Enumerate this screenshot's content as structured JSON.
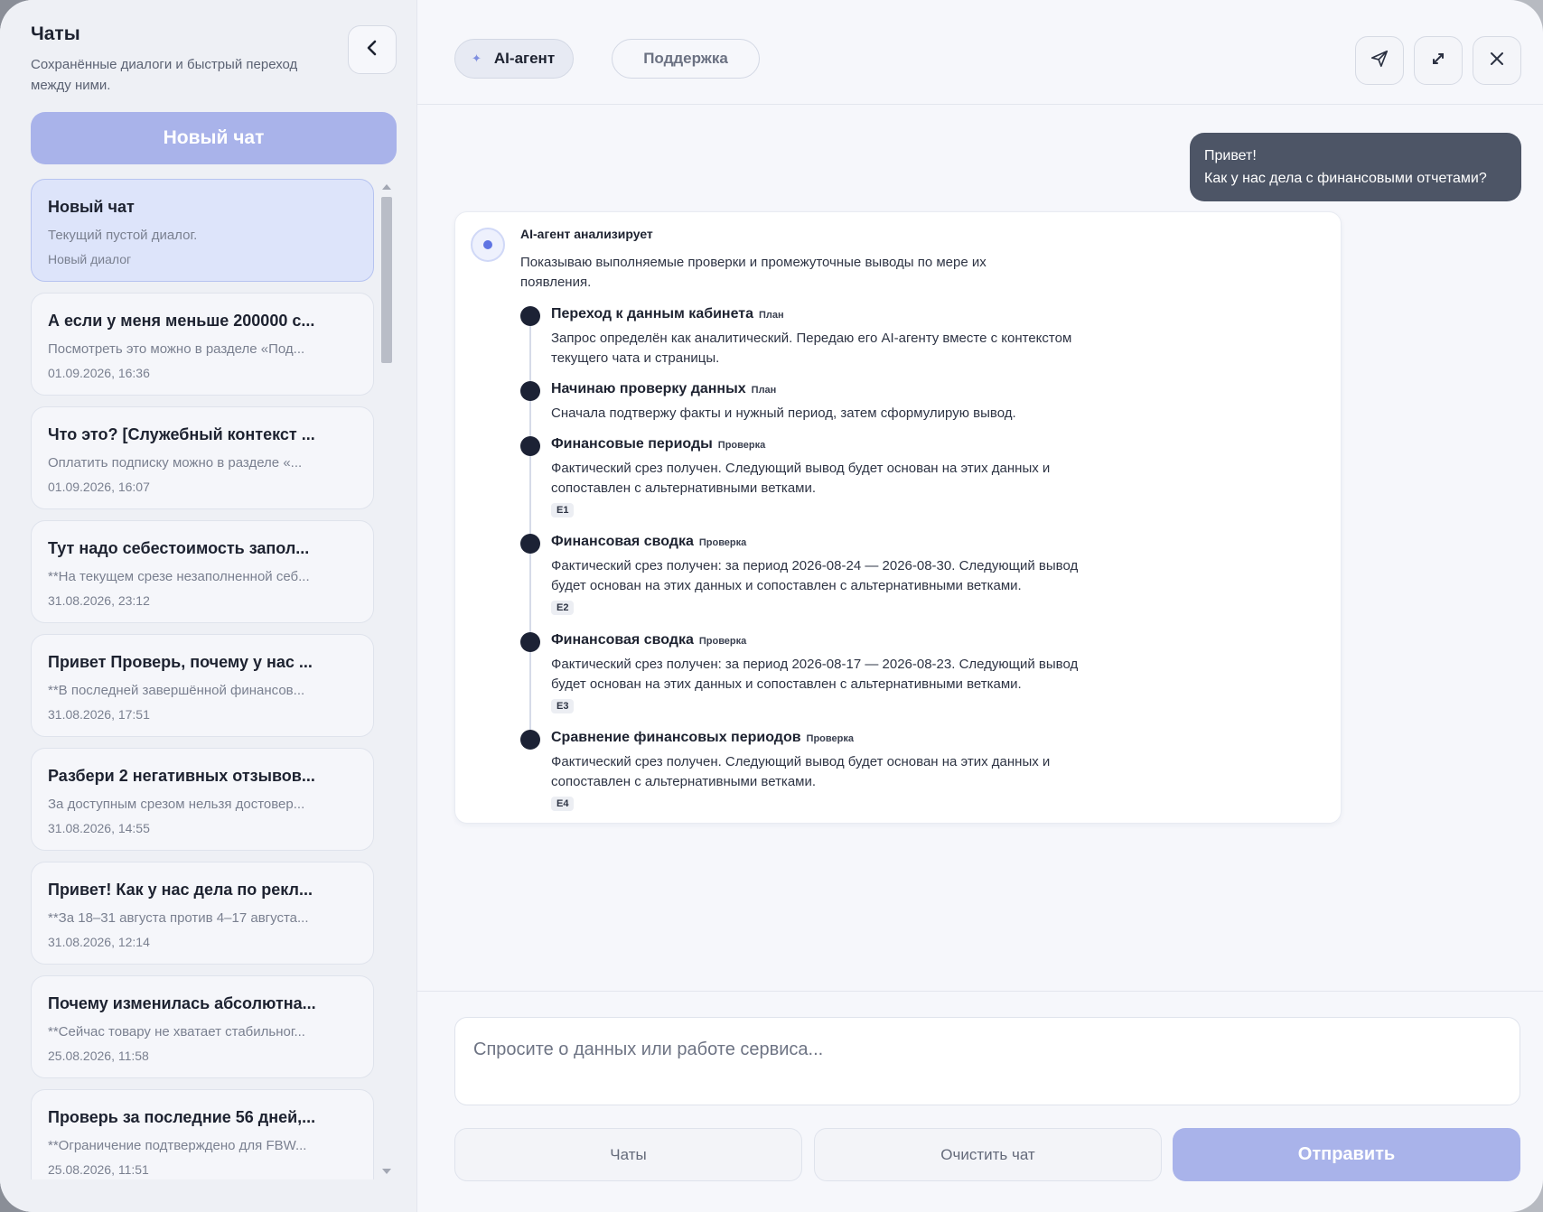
{
  "sidebar": {
    "title": "Чаты",
    "subtitle": "Сохранённые диалоги и быстрый переход между ними.",
    "new_chat_label": "Новый чат",
    "chats": [
      {
        "title": "Новый чат",
        "preview": "Текущий пустой диалог.",
        "date": "Новый диалог",
        "active": true
      },
      {
        "title": "А если у меня меньше 200000 с...",
        "preview": "Посмотреть это можно в разделе «Под...",
        "date": "01.09.2026, 16:36"
      },
      {
        "title": "Что это? [Служебный контекст ...",
        "preview": "Оплатить подписку можно в разделе «...",
        "date": "01.09.2026, 16:07"
      },
      {
        "title": "Тут надо себестоимость запол...",
        "preview": "**На текущем срезе незаполненной себ...",
        "date": "31.08.2026, 23:12"
      },
      {
        "title": "Привет Проверь, почему у нас ...",
        "preview": "**В последней завершённой финансов...",
        "date": "31.08.2026, 17:51"
      },
      {
        "title": "Разбери 2 негативных отзывов...",
        "preview": "За доступным срезом нельзя достовер...",
        "date": "31.08.2026, 14:55"
      },
      {
        "title": "Привет! Как у нас дела по рекл...",
        "preview": "**За 18–31 августа против 4–17 августа...",
        "date": "31.08.2026, 12:14"
      },
      {
        "title": "Почему изменилась абсолютна...",
        "preview": "**Сейчас товару не хватает стабильног...",
        "date": "25.08.2026, 11:58"
      },
      {
        "title": "Проверь за последние 56 дней,...",
        "preview": "**Ограничение подтверждено для FBW...",
        "date": "25.08.2026, 11:51"
      }
    ]
  },
  "header": {
    "tab_ai": "AI-агент",
    "tab_support": "Поддержка",
    "icons": [
      "send-icon",
      "expand-icon",
      "close-icon"
    ]
  },
  "messages": {
    "user": {
      "line1": "Привет!",
      "line2": "Как у нас дела с финансовыми отчетами?"
    },
    "agent": {
      "heading": "AI-агент анализирует",
      "description": "Показываю выполняемые проверки и промежуточные выводы по мере их появления.",
      "steps": [
        {
          "title": "Переход к данным кабинета",
          "tag": "План",
          "text": "Запрос определён как аналитический. Передаю его AI-агенту вместе с контекстом текущего чата и страницы.",
          "evidence": ""
        },
        {
          "title": "Начинаю проверку данных",
          "tag": "План",
          "text": "Сначала подтвержу факты и нужный период, затем сформулирую вывод.",
          "evidence": ""
        },
        {
          "title": "Финансовые периоды",
          "tag": "Проверка",
          "text": "Фактический срез получен. Следующий вывод будет основан на этих данных и сопоставлен с альтернативными ветками.",
          "evidence": "E1"
        },
        {
          "title": "Финансовая сводка",
          "tag": "Проверка",
          "text": "Фактический срез получен: за период 2026-08-24 — 2026-08-30. Следующий вывод будет основан на этих данных и сопоставлен с альтернативными ветками.",
          "evidence": "E2"
        },
        {
          "title": "Финансовая сводка",
          "tag": "Проверка",
          "text": "Фактический срез получен: за период 2026-08-17 — 2026-08-23. Следующий вывод будет основан на этих данных и сопоставлен с альтернативными ветками.",
          "evidence": "E3"
        },
        {
          "title": "Сравнение финансовых периодов",
          "tag": "Проверка",
          "text": "Фактический срез получен. Следующий вывод будет основан на этих данных и сопоставлен с альтернативными ветками.",
          "evidence": "E4"
        }
      ]
    }
  },
  "composer": {
    "placeholder": "Спросите о данных или работе сервиса...",
    "chats_button": "Чаты",
    "clear_button": "Очистить чат",
    "send_button": "Отправить"
  },
  "colors": {
    "accent": "#a9b3ea",
    "user_bubble": "#4d5566",
    "timeline_dot": "#1c2235",
    "active_chat": "#dde4fa"
  }
}
